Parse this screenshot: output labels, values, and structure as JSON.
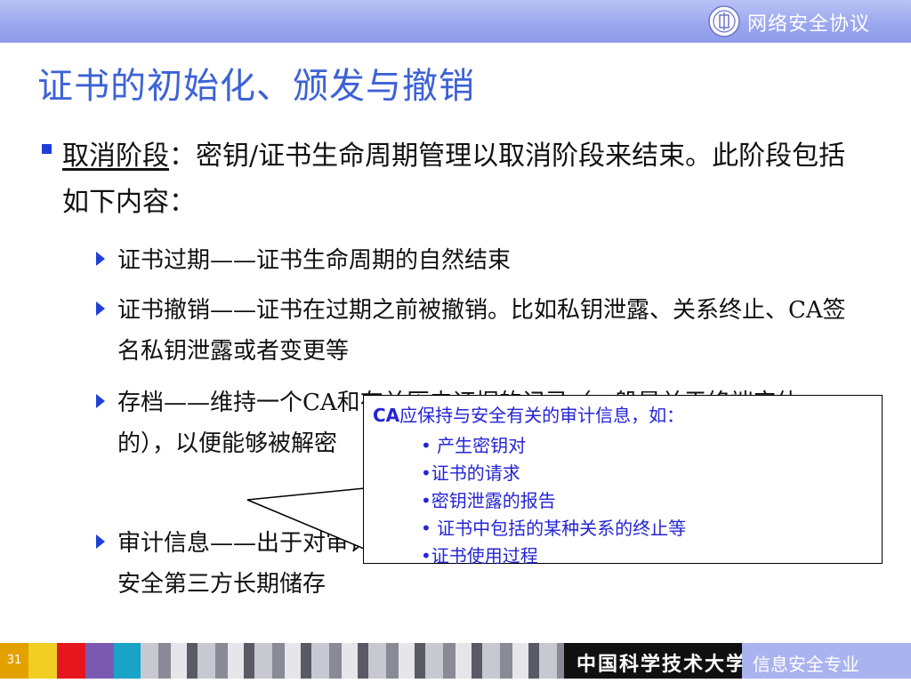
{
  "header": {
    "title": "网络安全协议",
    "logo": "university-seal-icon"
  },
  "page": {
    "title": "证书的初始化、颁发与撤销"
  },
  "main_bullet": {
    "term": "取消阶段",
    "text": "：密钥/证书生命周期管理以取消阶段来结束。此阶段包括如下内容："
  },
  "sub_items": [
    {
      "text": "证书过期——证书生命周期的自然结束"
    },
    {
      "text": "证书撤销——证书在过期之前被撤销。比如私钥泄露、关系终止、CA签名私钥泄露或者变更等"
    },
    {
      "text": "存档——维持一个CA和有关历史证据的记录（一般是关于终端实体的），以便能够被解密"
    },
    {
      "text": "审计信息——出于对审计和安全的考虑所进行的密钥资料的安全第三方长期储存"
    }
  ],
  "callout": {
    "head_bold": "CA",
    "head": "应保持与安全有关的审计信息，如：",
    "items": [
      "• 产生密钥对",
      "•证书的请求",
      "•密钥泄露的报告",
      "• 证书中包括的某种关系的终止等",
      "•证书使用过程"
    ]
  },
  "footer": {
    "slide_number": "31",
    "university": "中国科学技术大学",
    "department": "信息安全专业",
    "swatch_colors": [
      "#e3a100",
      "#f0cf22",
      "#e5161d",
      "#7a5ab0",
      "#19a3c9"
    ]
  }
}
